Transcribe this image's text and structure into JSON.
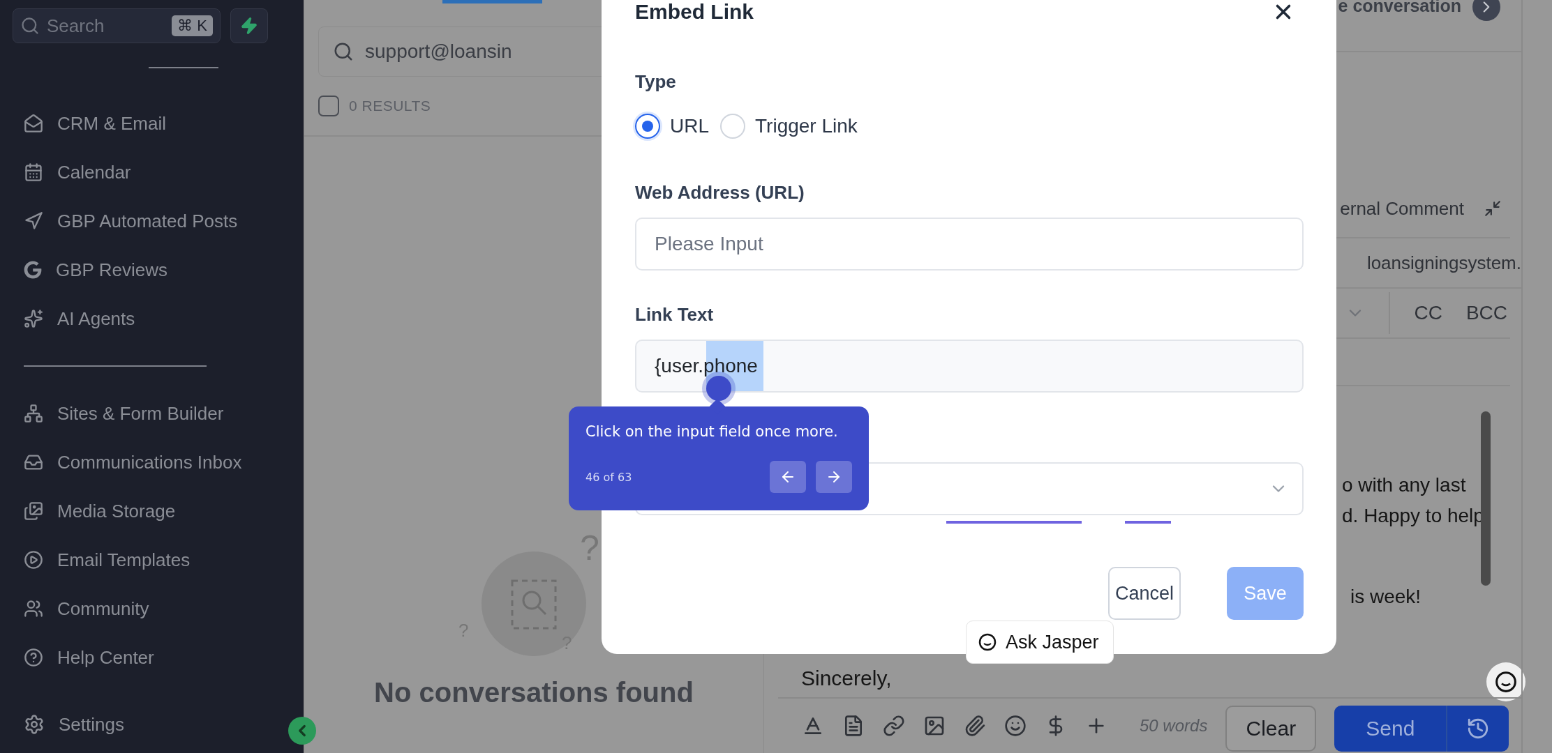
{
  "sidebar": {
    "search": {
      "placeholder": "Search",
      "shortcut": "⌘ K"
    },
    "sections": [
      {
        "items": [
          {
            "label": "CRM & Email"
          },
          {
            "label": "Calendar"
          },
          {
            "label": "GBP Automated Posts"
          },
          {
            "label": "GBP Reviews"
          },
          {
            "label": "AI Agents"
          }
        ]
      },
      {
        "items": [
          {
            "label": "Sites & Form Builder"
          },
          {
            "label": "Communications Inbox"
          },
          {
            "label": "Media Storage"
          },
          {
            "label": "Email Templates"
          },
          {
            "label": "Community"
          },
          {
            "label": "Help Center"
          }
        ]
      }
    ],
    "footer_item": {
      "label": "Settings"
    }
  },
  "conversations": {
    "search": {
      "value": "support@loansin"
    },
    "select_all": {
      "checked": false
    },
    "results": "0 RESULTS",
    "empty_state": {
      "marks": [
        "?",
        "?",
        "?"
      ],
      "message": "No conversations found"
    }
  },
  "modal": {
    "title": "Embed Link",
    "type": {
      "label": "Type",
      "options": [
        {
          "label": "URL",
          "selected": true
        },
        {
          "label": "Trigger Link",
          "selected": false
        }
      ]
    },
    "web_address": {
      "label": "Web Address (URL)",
      "placeholder": "Please Input"
    },
    "link_text": {
      "label": "Link Text",
      "value": "{user.phone"
    },
    "cancel": "Cancel",
    "save": "Save"
  },
  "tour_tip": {
    "text": "Click on the input field once more.",
    "progress": "46 of 63"
  },
  "ask_jasper": "Ask Jasper",
  "composer": {
    "header": "e conversation",
    "mode": "ernal Comment",
    "from": "loansigningsystem.",
    "cc": "CC",
    "bcc": "BCC",
    "body": [
      "o with any last",
      "d. Happy to help",
      "is week!"
    ],
    "closing": "Sincerely,",
    "word_count": "50 words",
    "clear": "Clear",
    "send": "Send"
  }
}
